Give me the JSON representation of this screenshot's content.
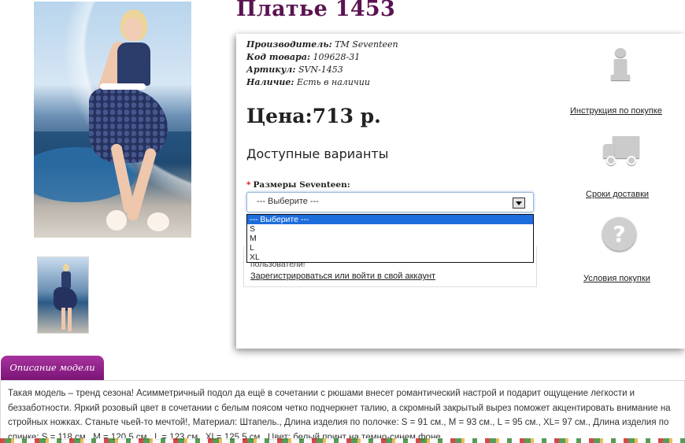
{
  "product": {
    "title": "Платье 1453",
    "manufacturer_label": "Производитель:",
    "manufacturer_value": "TM Seventeen",
    "code_label": "Код товара:",
    "code_value": "109628-31",
    "article_label": "Артикул:",
    "article_value": "SVN-1453",
    "availability_label": "Наличие:",
    "availability_value": "Есть в наличии",
    "price": "Цена:713 р."
  },
  "options": {
    "heading": "Доступные варианты",
    "size_label": "Размеры Seventeen:",
    "required_mark": "*",
    "select_value": "--- Выберите ---",
    "dropdown_items": [
      "--- Выберите ---",
      "S",
      "M",
      "L",
      "XL"
    ]
  },
  "login": {
    "note": "пользователи!",
    "link": "Зарегистрироваться или войти в свой аккаунт"
  },
  "side_links": {
    "purchase_instructions": "Инструкция по покупке",
    "delivery_terms": "Сроки доставки",
    "purchase_conditions": "Условия покупки"
  },
  "description": {
    "tab_label": "Описание модели",
    "text": "Такая модель – тренд сезона! Асимметричный подол да ещё в сочетании с рюшами внесет романтический настрой и подарит ощущение легкости и беззаботности. Яркий розовый цвет в сочетании с белым поясом четко подчеркнет талию, а скромный закрытый вырез поможет акцентировать внимание на стройных ножках. Станьте чьей-то мечтой!, Материал: Штапель., Длина изделия по полочке: S = 91 см., M = 93 см., L = 95 см., XL= 97 см., Длина изделия по спинке: S = 118 см., M = 120,5 см., L = 123 см., XL= 125,5 см., Цвет: белый принт на темно-синем фоне."
  },
  "colors": {
    "title": "#5a1351",
    "tab": "#8e2188",
    "selected_option": "#1e6ddc",
    "required": "#dd0000"
  },
  "icons": [
    "info-icon",
    "truck-icon",
    "question-icon"
  ]
}
